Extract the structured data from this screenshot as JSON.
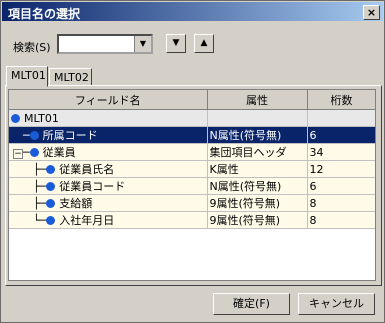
{
  "window": {
    "title": "項目名の選択",
    "close_icon": "close-icon"
  },
  "search": {
    "label": "検索(S)",
    "value": ""
  },
  "tabs": [
    "MLT01",
    "MLT02"
  ],
  "table": {
    "headers": [
      "フィールド名",
      "属性",
      "桁数"
    ],
    "rows": [
      {
        "name": "MLT01",
        "attr": "",
        "digits": ""
      },
      {
        "name": "所属コード",
        "attr": "N属性(符号無)",
        "digits": "6"
      },
      {
        "name": "従業員",
        "attr": "集団項目ヘッダ",
        "digits": "34"
      },
      {
        "name": "従業員氏名",
        "attr": "K属性",
        "digits": "12"
      },
      {
        "name": "従業員コード",
        "attr": "N属性(符号無)",
        "digits": "6"
      },
      {
        "name": "支給額",
        "attr": "9属性(符号無)",
        "digits": "8"
      },
      {
        "name": "入社年月日",
        "attr": "9属性(符号無)",
        "digits": "8"
      }
    ]
  },
  "buttons": {
    "ok": "確定(F)",
    "cancel": "キャンセル"
  }
}
